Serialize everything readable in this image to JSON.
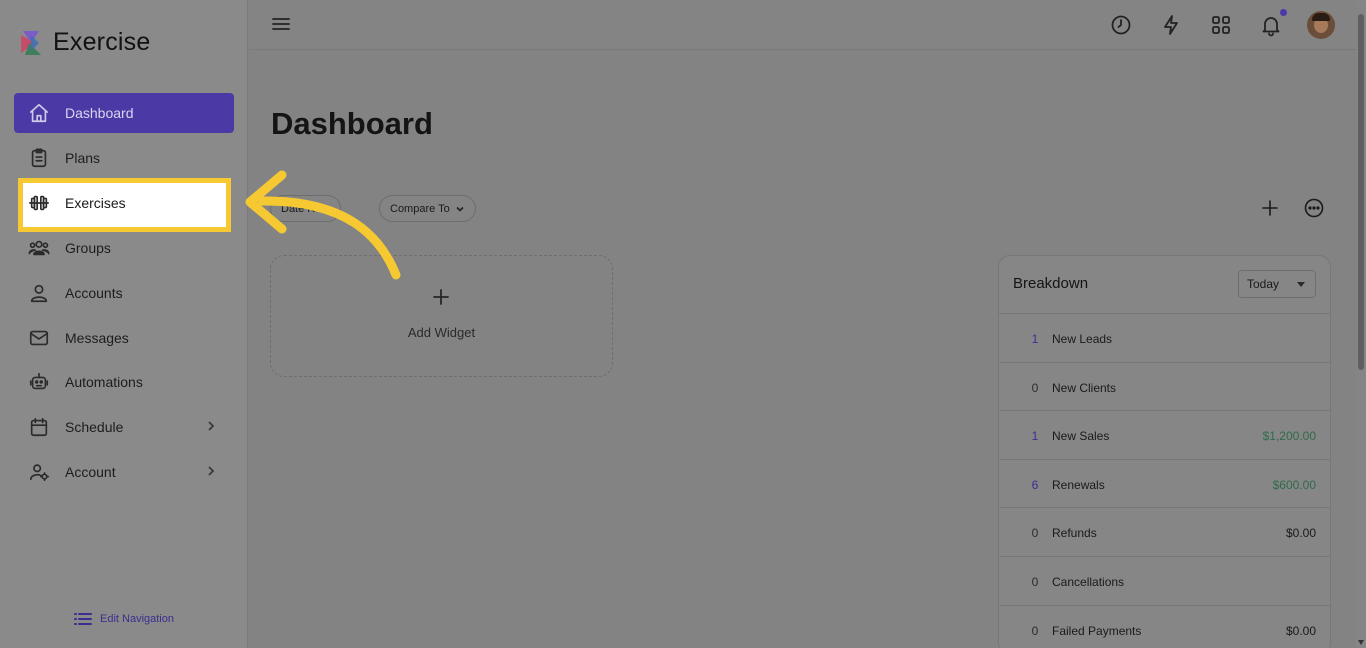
{
  "brand": {
    "name": "Exercise"
  },
  "sidebar": {
    "items": [
      {
        "label": "Dashboard",
        "icon": "home-icon"
      },
      {
        "label": "Plans",
        "icon": "clipboard-icon"
      },
      {
        "label": "Exercises",
        "icon": "dumbbell-icon"
      },
      {
        "label": "Groups",
        "icon": "users-icon"
      },
      {
        "label": "Accounts",
        "icon": "user-icon"
      },
      {
        "label": "Messages",
        "icon": "mail-icon"
      },
      {
        "label": "Automations",
        "icon": "robot-icon"
      },
      {
        "label": "Schedule",
        "icon": "calendar-icon"
      },
      {
        "label": "Account",
        "icon": "user-gear-icon"
      }
    ],
    "edit_navigation": "Edit Navigation"
  },
  "main": {
    "title": "Dashboard",
    "filters": {
      "date_range": "Date R",
      "compare_to": "Compare To"
    },
    "add_widget": "Add Widget"
  },
  "breakdown": {
    "title": "Breakdown",
    "period": "Today",
    "rows": [
      {
        "count": "1",
        "name": "New Leads",
        "amount": ""
      },
      {
        "count": "0",
        "name": "New Clients",
        "amount": ""
      },
      {
        "count": "1",
        "name": "New Sales",
        "amount": "$1,200.00"
      },
      {
        "count": "6",
        "name": "Renewals",
        "amount": "$600.00"
      },
      {
        "count": "0",
        "name": "Refunds",
        "amount": "$0.00"
      },
      {
        "count": "0",
        "name": "Cancellations",
        "amount": ""
      },
      {
        "count": "0",
        "name": "Failed Payments",
        "amount": "$0.00"
      }
    ]
  },
  "colors": {
    "accent": "#4b3aa6",
    "highlight": "#f6c933",
    "positive_amount": "#2f6b4b"
  }
}
